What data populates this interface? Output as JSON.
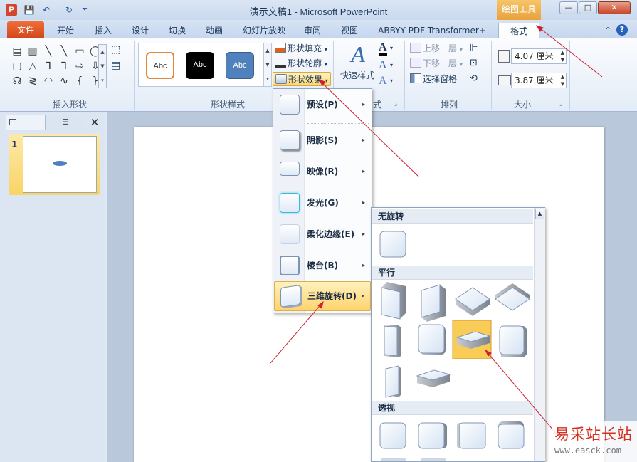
{
  "window": {
    "title": "演示文稿1 - Microsoft PowerPoint",
    "app_icon": "P",
    "context_tab_header": "绘图工具",
    "controls": {
      "minimize": "—",
      "restore": "□",
      "close": "✕"
    }
  },
  "quick_access": {
    "save": "💾",
    "undo": "↶",
    "redo": "↻",
    "more": "⏷"
  },
  "tabs": [
    "文件",
    "开始",
    "插入",
    "设计",
    "切换",
    "动画",
    "幻灯片放映",
    "审阅",
    "视图",
    "ABBYY PDF Transformer+",
    "格式"
  ],
  "active_tab": "格式",
  "tab_right_icons": {
    "collapse": "⌃",
    "help": "?"
  },
  "ribbon": {
    "insert_shapes": {
      "label": "插入形状",
      "glyphs": [
        "▤",
        "▥",
        "╲",
        "╲",
        "▭",
        "◯",
        "▢",
        "△",
        "⅂",
        "⅂",
        "⇨",
        "⇩",
        "☊",
        "≷",
        "◠",
        "∿",
        "{",
        "}"
      ],
      "edit_shape": "⬚",
      "textbox": "▤"
    },
    "shape_styles": {
      "label": "形状样式",
      "swatches": [
        {
          "text": "Abc",
          "bg": "#ffffff",
          "fg": "#333333",
          "border": "#e0873a"
        },
        {
          "text": "Abc",
          "bg": "#000000",
          "fg": "#ffffff",
          "border": "#000000"
        },
        {
          "text": "Abc",
          "bg": "#4f81bd",
          "fg": "#ffffff",
          "border": "#3a5f8f"
        }
      ],
      "fill": "形状填充",
      "outline": "形状轮廓",
      "effects": "形状效果"
    },
    "art": {
      "quick_styles": "快速样式",
      "label_tail": "式"
    },
    "arrange": {
      "label": "排列",
      "bring_forward": "上移一层",
      "send_backward": "下移一层",
      "selection_pane": "选择窗格"
    },
    "size": {
      "label": "大小",
      "height": "4.07 厘米",
      "width": "3.87 厘米"
    }
  },
  "slides_panel": {
    "slide_number": "1"
  },
  "effects_menu": {
    "items": [
      {
        "label": "预设(P)"
      },
      {
        "label": "阴影(S)"
      },
      {
        "label": "映像(R)"
      },
      {
        "label": "发光(G)"
      },
      {
        "label": "柔化边缘(E)"
      },
      {
        "label": "棱台(B)"
      },
      {
        "label": "三维旋转(D)"
      }
    ],
    "active_index": 6,
    "arrow": "▸"
  },
  "rotation_gallery": {
    "sections": [
      "无旋转",
      "平行",
      "透视"
    ],
    "selected_index": 6,
    "scroll_up": "▲"
  },
  "watermark": {
    "text": "易采站长站",
    "url": "www.easck.com"
  },
  "colors": {
    "accent": "#d2461a",
    "highlight": "#ffd36c",
    "ribbon": "#e3ecf7"
  }
}
